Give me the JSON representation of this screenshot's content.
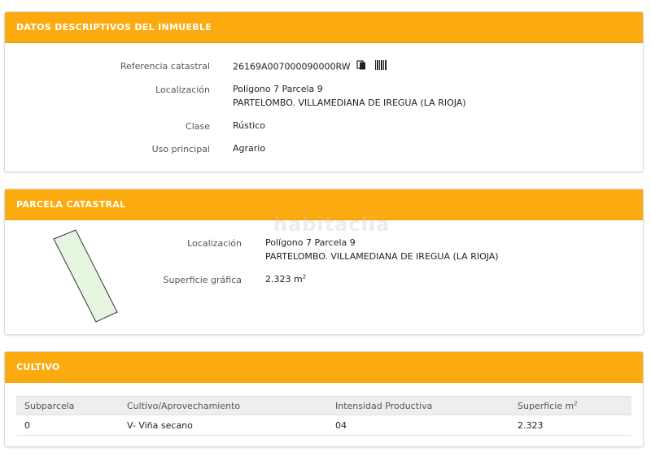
{
  "panels": {
    "datos": {
      "title": "DATOS DESCRIPTIVOS DEL INMUEBLE",
      "rows": [
        {
          "label": "Referencia catastral",
          "value": "26169A007000090000RW"
        },
        {
          "label": "Localización",
          "value": "Polígono 7 Parcela 9",
          "value2": "PARTELOMBO. VILLAMEDIANA DE IREGUA (LA RIOJA)"
        },
        {
          "label": "Clase",
          "value": "Rústico"
        },
        {
          "label": "Uso principal",
          "value": "Agrario"
        }
      ],
      "icons": [
        "copy-icon",
        "barcode-icon"
      ]
    },
    "parcela": {
      "title": "PARCELA CATASTRAL",
      "localizacion_label": "Localización",
      "localizacion_value": "Polígono 7 Parcela 9",
      "localizacion_value2": "PARTELOMBO. VILLAMEDIANA DE IREGUA (LA RIOJA)",
      "superficie_label": "Superficie gráfica",
      "superficie_value": "2.323 m",
      "superficie_unit_sup": "2",
      "parcel_fill": "#e6f5e0",
      "parcel_stroke": "#333333"
    },
    "cultivo": {
      "title": "CULTIVO",
      "headers": [
        "Subparcela",
        "Cultivo/Aprovechamiento",
        "Intensidad Productiva",
        "Superficie m"
      ],
      "header_sup": "2",
      "rows": [
        [
          "0",
          "V- Viña secano",
          "04",
          "2.323"
        ]
      ]
    }
  },
  "watermark": "habitaclia",
  "colors": {
    "accent": "#fbab0f"
  }
}
